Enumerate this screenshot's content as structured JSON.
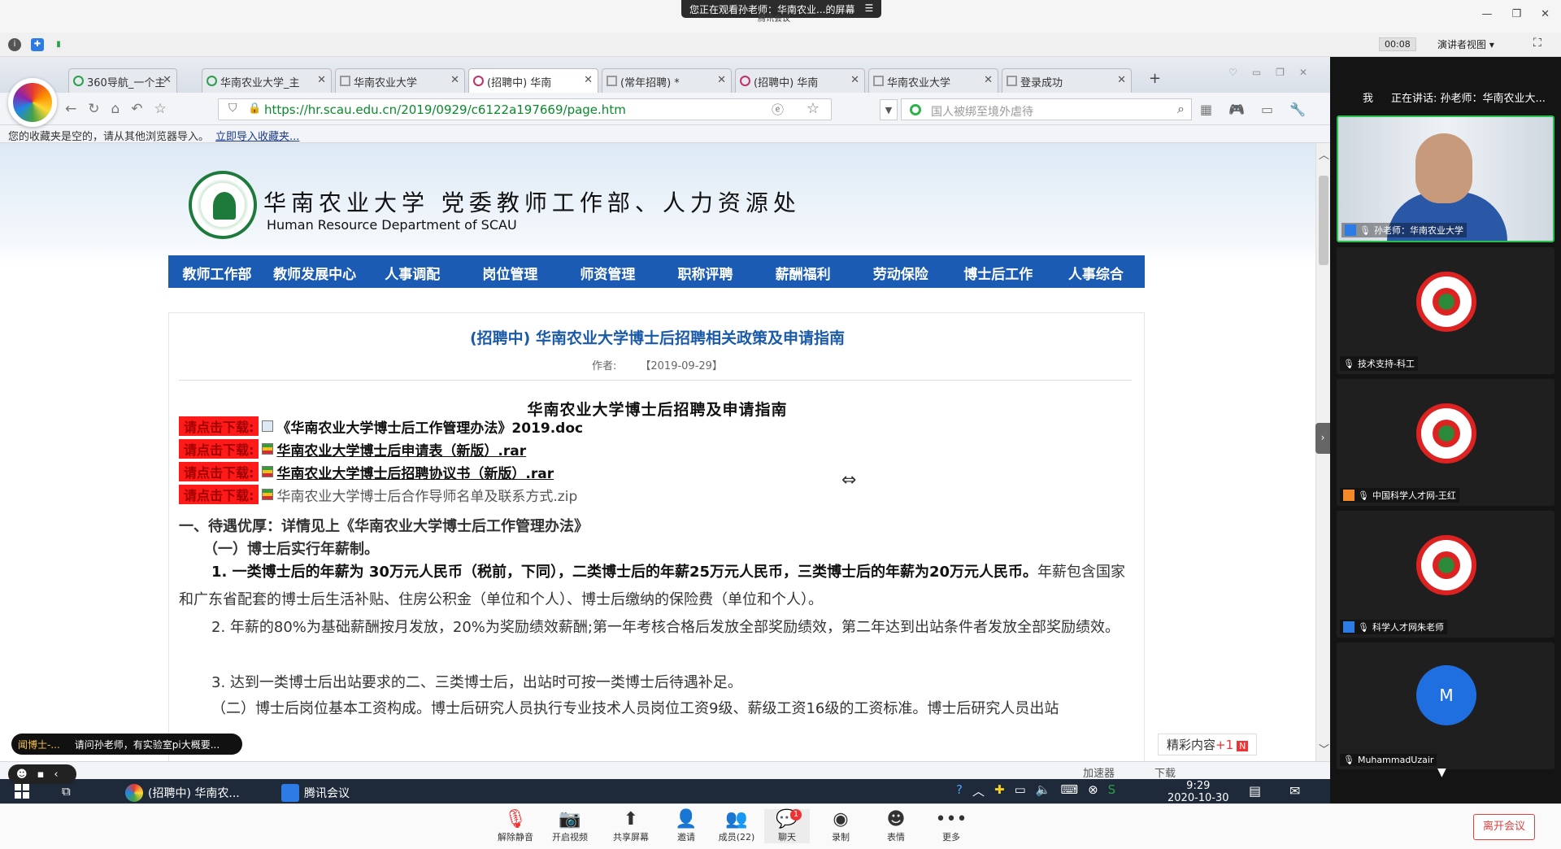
{
  "meeting": {
    "banner": "您正在观看孙老师：华南农业...的屏幕",
    "banner_sub": "腾讯会议",
    "timer": "00:08",
    "view_mode": "演讲者视图",
    "speaking": "正在讲话: 孙老师：华南农业大...",
    "me_label": "我"
  },
  "browser": {
    "tabs": [
      {
        "label": "360导航_一个主"
      },
      {
        "label": "华南农业大学_主"
      },
      {
        "label": "华南农业大学"
      },
      {
        "label": "(招聘中) 华南"
      },
      {
        "label": "(常年招聘) *"
      },
      {
        "label": "(招聘中) 华南"
      },
      {
        "label": "华南农业大学"
      },
      {
        "label": "登录成功"
      }
    ],
    "url": "https://hr.scau.edu.cn/2019/0929/c6122a197669/page.htm",
    "search_placeholder": "国人被绑至境外虐待",
    "bookmark_notice": "您的收藏夹是空的，请从其他浏览器导入。",
    "bookmark_link": "立即导入收藏夹...",
    "accel": "加速器",
    "download": "下载"
  },
  "site": {
    "title": "华南农业大学  党委教师工作部、人力资源处",
    "title_en": "Human Resource Department of SCAU",
    "nav": [
      "教师工作部",
      "教师发展中心",
      "人事调配",
      "岗位管理",
      "师资管理",
      "职称评聘",
      "薪酬福利",
      "劳动保险",
      "博士后工作",
      "人事综合"
    ]
  },
  "article": {
    "title": "(招聘中) 华南农业大学博士后招聘相关政策及申请指南",
    "author_label": "作者:",
    "date": "【2019-09-29】",
    "subtitle": "华南农业大学博士后招聘及申请指南",
    "download_tag": "请点击下载:",
    "downloads": [
      "《华南农业大学博士后工作管理办法》2019.doc",
      "华南农业大学博士后申请表（新版）.rar",
      "华南农业大学博士后招聘协议书（新版）.rar",
      "华南农业大学博士后合作导师名单及联系方式.zip"
    ],
    "section1": "一、待遇优厚：详情见上《华南农业大学博士后工作管理办法》",
    "sub1": "（一）博士后实行年薪制。",
    "p1_bold": "1. 一类博士后的年薪为 30万元人民币（税前，下同），二类博士后的年薪25万元人民币，三类博士后的年薪为20万元人民币。",
    "p1_rest": "年薪包含国家和广东省配套的博士后生活补贴、住房公积金（单位和个人）、博士后缴纳的保险费（单位和个人）。",
    "p2": "2. 年薪的80%为基础薪酬按月发放，20%为奖励绩效薪酬;第一年考核合格后发放全部奖励绩效，第二年达到出站条件者发放全部奖励绩效。",
    "p3": "3. 达到一类博士后出站要求的二、三类博士后，出站时可按一类博士后待遇补足。",
    "p4": "（二）博士后岗位基本工资构成。博士后研究人员执行专业技术人员岗位工资9级、薪级工资16级的工资标准。博士后研究人员出站"
  },
  "popup": {
    "label": "精彩内容",
    "count": "+1"
  },
  "chat": {
    "who": "闻博士-...",
    "text": "请问孙老师，有实验室pi大概要..."
  },
  "taskbar": {
    "apps": [
      "(招聘中) 华南农...",
      "腾讯会议"
    ],
    "time": "9:29",
    "date": "2020-10-30"
  },
  "participants": [
    {
      "name": "孙老师：华南农业大学",
      "type": "video"
    },
    {
      "name": "技术支持-科工",
      "type": "logo"
    },
    {
      "name": "中国科学人才网-王红",
      "type": "logo"
    },
    {
      "name": "科学人才网朱老师",
      "type": "logo"
    },
    {
      "name": "MuhammadUzair",
      "type": "initial",
      "initial": "M"
    }
  ],
  "toolbar": {
    "unmute": "解除静音",
    "video": "开启视频",
    "share": "共享屏幕",
    "invite": "邀请",
    "members": "成员(22)",
    "chat": "聊天",
    "chat_badge": "1",
    "record": "录制",
    "emoji": "表情",
    "more": "更多",
    "leave": "离开会议"
  }
}
